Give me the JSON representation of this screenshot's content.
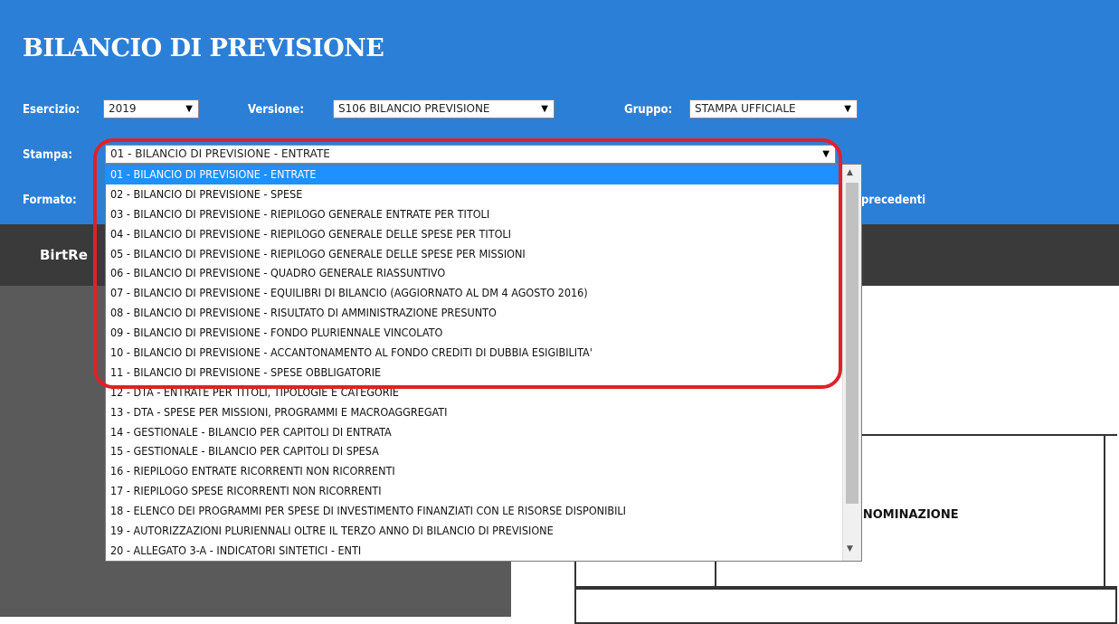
{
  "header": {
    "title": "BILANCIO DI PREVISIONE",
    "esercizio_label": "Esercizio:",
    "esercizio_value": "2019",
    "versione_label": "Versione:",
    "versione_value": "S106 BILANCIO PREVISIONE",
    "gruppo_label": "Gruppo:",
    "gruppo_value": "STAMPA UFFICIALE",
    "stampa_label": "Stampa:",
    "stampa_value": "01 - BILANCIO DI PREVISIONE - ENTRATE",
    "formato_label": "Formato:",
    "precedenti_text": "precedenti"
  },
  "toolbar": {
    "birt_label": "BirtRe"
  },
  "report": {
    "denominazione": "ENOMINAZIONE"
  },
  "dropdown": {
    "options": [
      "01 - BILANCIO DI PREVISIONE - ENTRATE",
      "02 - BILANCIO DI PREVISIONE - SPESE",
      "03 - BILANCIO DI PREVISIONE - RIEPILOGO GENERALE ENTRATE PER TITOLI",
      "04 - BILANCIO DI PREVISIONE - RIEPILOGO GENERALE DELLE SPESE PER TITOLI",
      "05 - BILANCIO DI PREVISIONE - RIEPILOGO GENERALE DELLE SPESE PER MISSIONI",
      "06 - BILANCIO DI PREVISIONE - QUADRO GENERALE RIASSUNTIVO",
      "07 - BILANCIO DI PREVISIONE - EQUILIBRI DI BILANCIO (AGGIORNATO AL DM 4 AGOSTO 2016)",
      "08 - BILANCIO DI PREVISIONE - RISULTATO DI AMMINISTRAZIONE PRESUNTO",
      "09 - BILANCIO DI PREVISIONE - FONDO PLURIENNALE VINCOLATO",
      "10 - BILANCIO DI PREVISIONE - ACCANTONAMENTO AL FONDO CREDITI DI DUBBIA ESIGIBILITA'",
      "11 - BILANCIO DI PREVISIONE - SPESE OBBLIGATORIE",
      "12 - DTA - ENTRATE PER TITOLI, TIPOLOGIE E CATEGORIE",
      "13 - DTA - SPESE PER MISSIONI, PROGRAMMI E MACROAGGREGATI",
      "14 - GESTIONALE - BILANCIO PER CAPITOLI DI ENTRATA",
      "15 - GESTIONALE - BILANCIO PER CAPITOLI DI SPESA",
      "16 - RIEPILOGO ENTRATE RICORRENTI NON RICORRENTI",
      "17 - RIEPILOGO SPESE RICORRENTI NON RICORRENTI",
      "18 - ELENCO DEI PROGRAMMI PER SPESE DI INVESTIMENTO FINANZIATI CON LE RISORSE DISPONIBILI",
      "19 - AUTORIZZAZIONI PLURIENNALI OLTRE IL TERZO ANNO DI BILANCIO DI PREVISIONE",
      "20 - ALLEGATO 3-A - INDICATORI SINTETICI - ENTI"
    ],
    "selected_index": 0
  },
  "colors": {
    "header_bg": "#2b7fd6",
    "highlight": "#e0202a",
    "selected_option": "#1e90ff"
  }
}
